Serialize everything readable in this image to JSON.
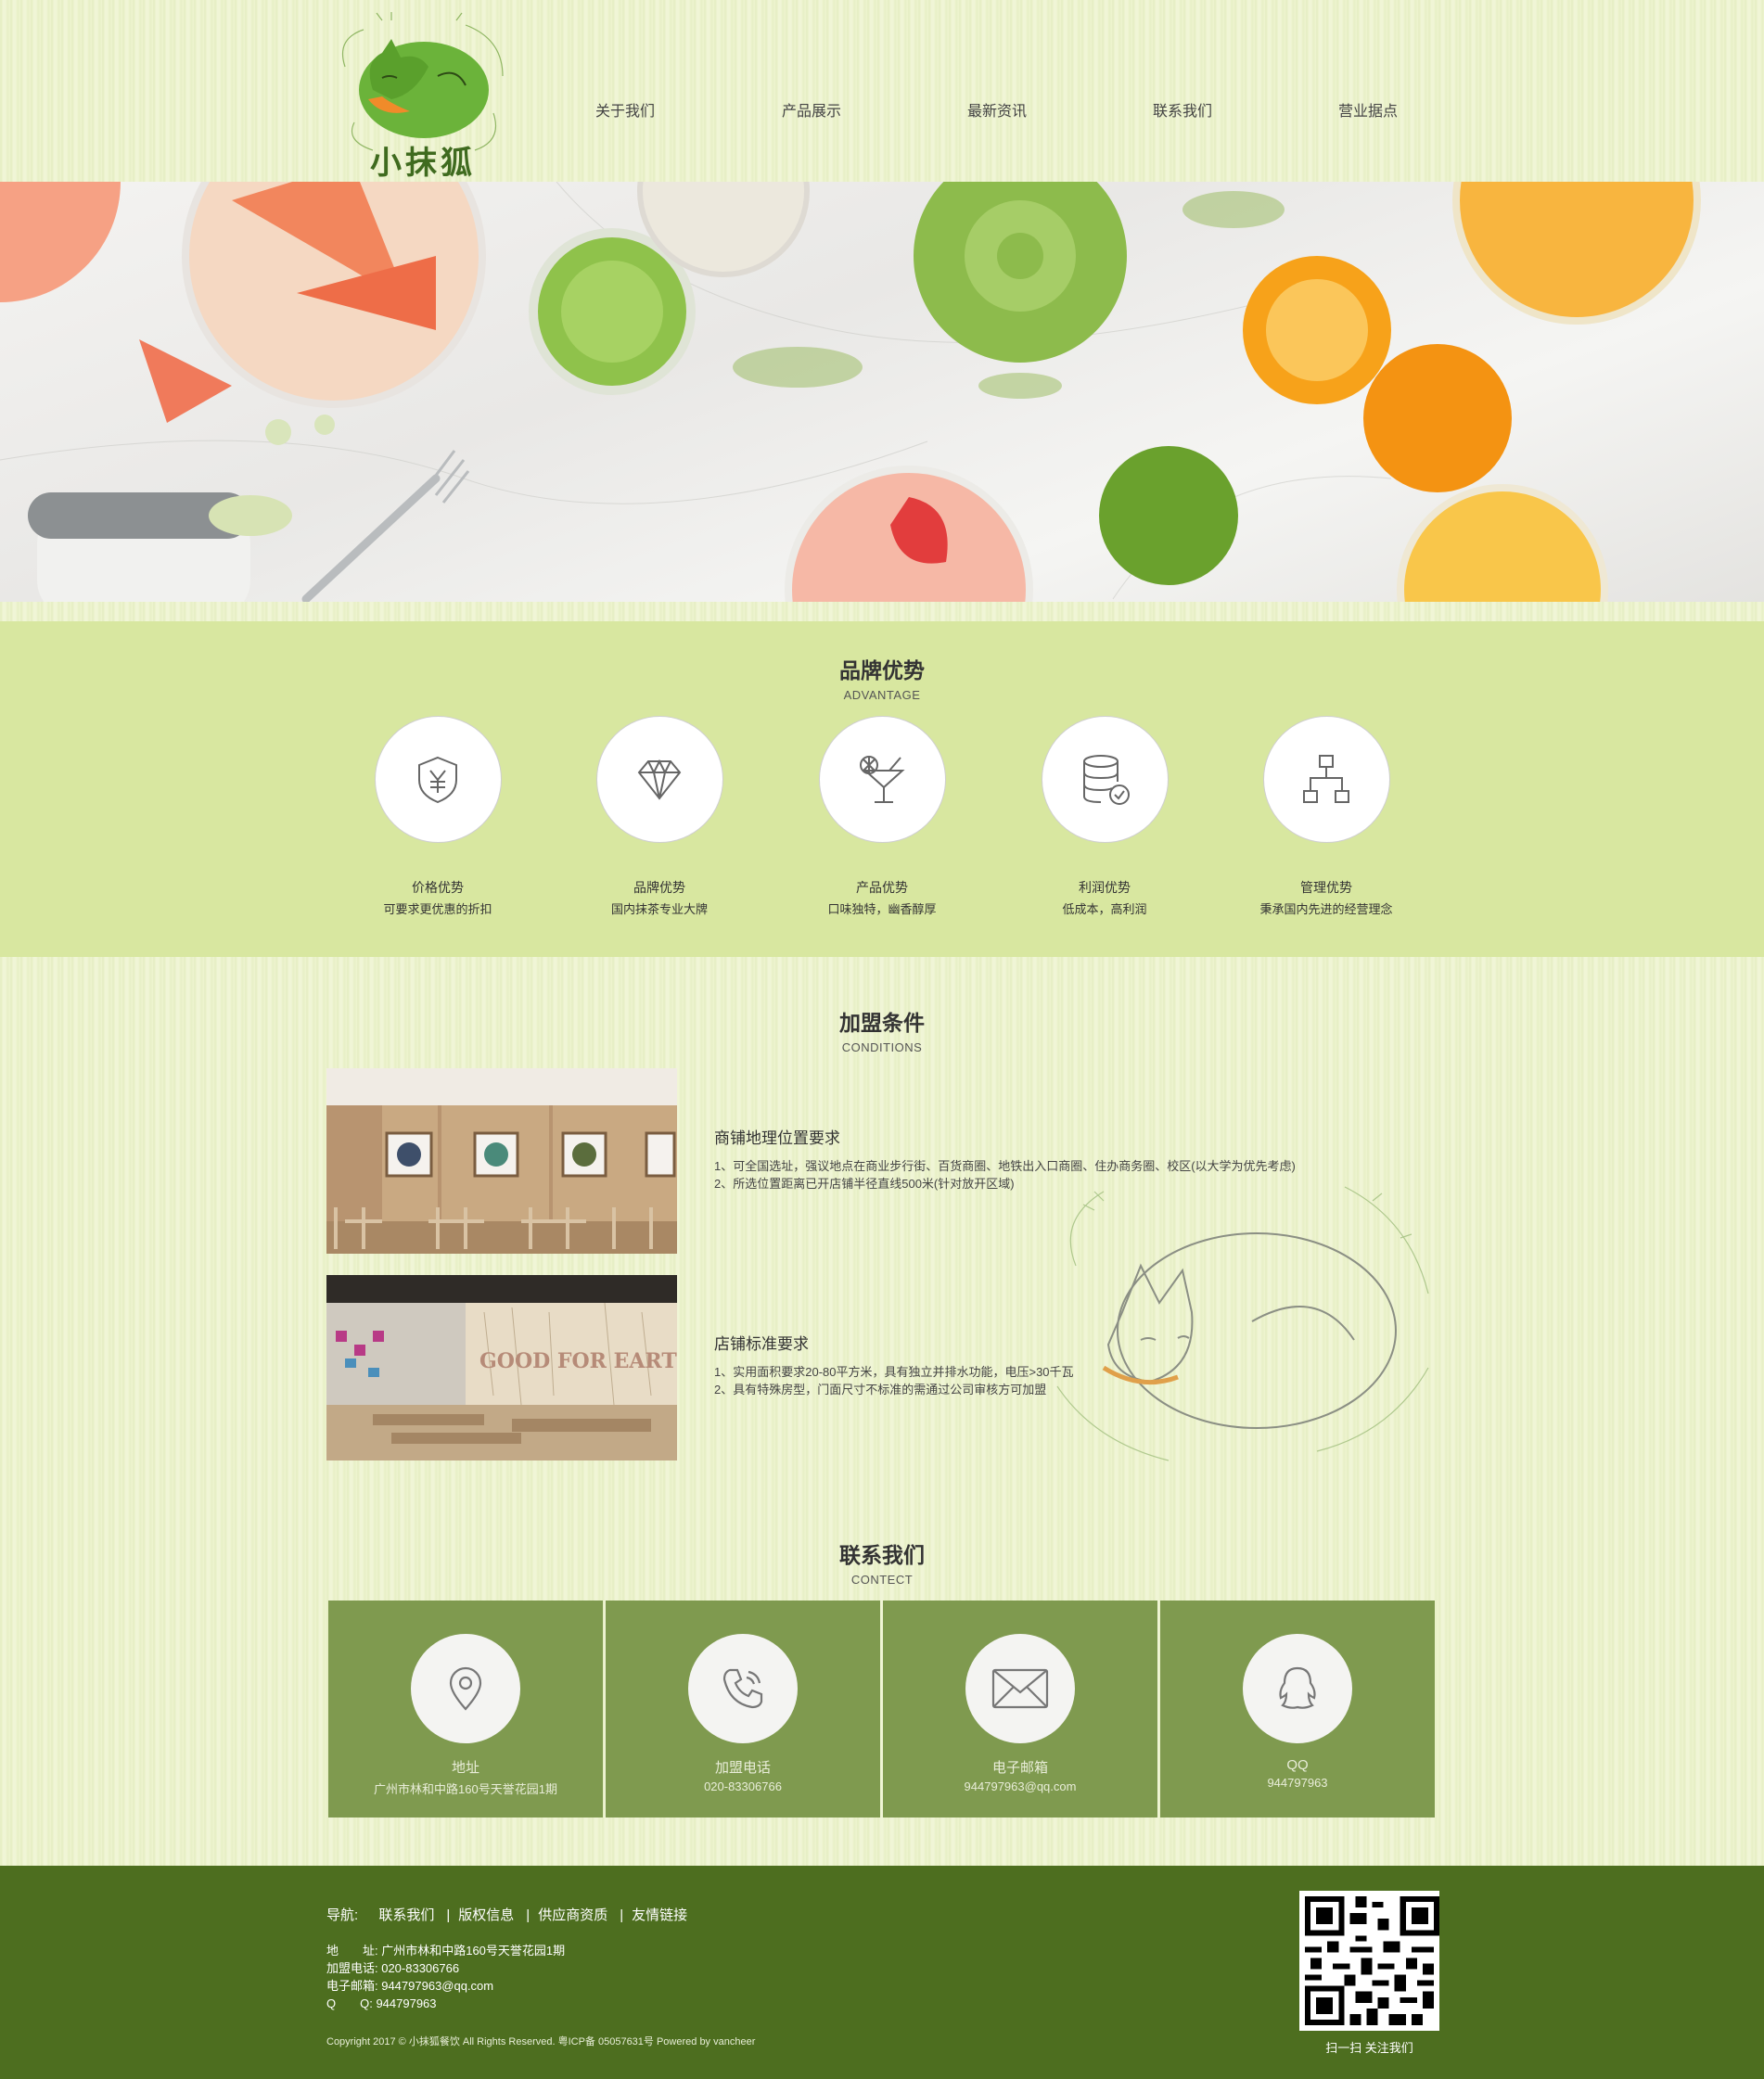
{
  "header": {
    "logo_text": "小抹狐",
    "nav": [
      "关于我们",
      "产品展示",
      "最新资讯",
      "联系我们",
      "营业据点"
    ]
  },
  "advantage": {
    "title": "品牌优势",
    "subtitle": "ADVANTAGE",
    "items": [
      {
        "icon": "shield-yen-icon",
        "title": "价格优势",
        "desc": "可要求更优惠的折扣"
      },
      {
        "icon": "diamond-icon",
        "title": "品牌优势",
        "desc": "国内抹茶专业大牌"
      },
      {
        "icon": "cocktail-icon",
        "title": "产品优势",
        "desc": "口味独特，幽香醇厚"
      },
      {
        "icon": "database-check-icon",
        "title": "利润优势",
        "desc": "低成本，高利润"
      },
      {
        "icon": "hierarchy-icon",
        "title": "管理优势",
        "desc": "秉承国内先进的经营理念"
      }
    ]
  },
  "conditions": {
    "title": "加盟条件",
    "subtitle": "CONDITIONS",
    "items": [
      {
        "title": "商铺地理位置要求",
        "lines": [
          "1、可全国选址，强议地点在商业步行街、百货商圈、地铁出入口商圈、住办商务圈、校区(以大学为优先考虑)",
          "2、所选位置距离已开店铺半径直线500米(针对放开区域)"
        ]
      },
      {
        "title": "店铺标准要求",
        "lines": [
          "1、实用面积要求20-80平方米，具有独立并排水功能，电压>30千瓦",
          "2、具有特殊房型，门面尺寸不标准的需通过公司审核方可加盟"
        ]
      }
    ],
    "store_sign": "GOOD FOR EARTH"
  },
  "contact": {
    "title": "联系我们",
    "subtitle": "CONTECT",
    "items": [
      {
        "icon": "location-pin-icon",
        "title": "地址",
        "value": "广州市林和中路160号天誉花园1期"
      },
      {
        "icon": "phone-icon",
        "title": "加盟电话",
        "value": "020-83306766"
      },
      {
        "icon": "mail-icon",
        "title": "电子邮箱",
        "value": "944797963@qq.com"
      },
      {
        "icon": "qq-icon",
        "title": "QQ",
        "value": "944797963"
      }
    ]
  },
  "footer": {
    "nav_label": "导航:",
    "links": [
      "联系我们",
      "版权信息",
      "供应商资质",
      "友情链接"
    ],
    "separator": "|",
    "info": [
      "地　　址:  广州市林和中路160号天誉花园1期",
      "加盟电话:  020-83306766",
      "电子邮箱:  944797963@qq.com",
      "Q　　Q:  944797963"
    ],
    "copyright": "Copyright 2017 © 小抹狐餐饮 All Rights Reserved. 粤ICP备 05057631号 Powered by vancheer",
    "qr_label": "扫一扫 关注我们"
  },
  "colors": {
    "advantage_bg": "#d8e7a0",
    "contact_box": "#7f9a4f",
    "footer_bg": "#4d6e1f"
  }
}
